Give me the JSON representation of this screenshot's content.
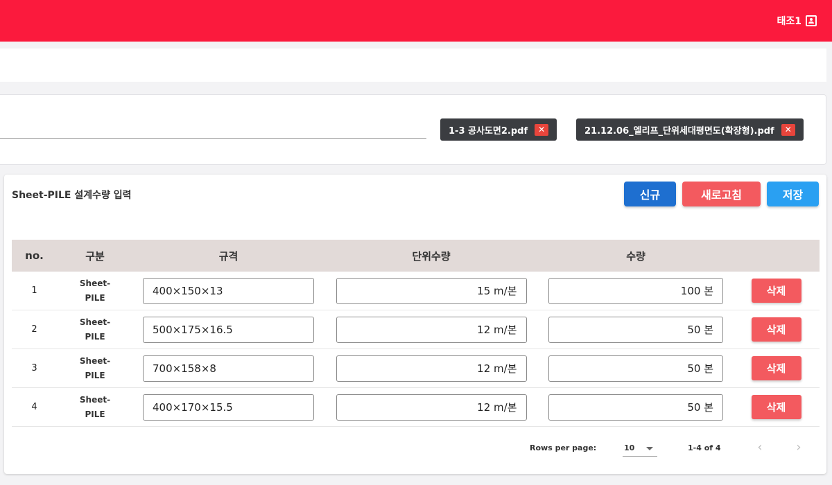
{
  "header": {
    "user_name": "태조1",
    "user_icon": "account-box-icon"
  },
  "attachments": [
    {
      "name": "1-3 공사도면2.pdf",
      "remove_icon": "close-icon"
    },
    {
      "name": "21.12.06_엘리프_단위세대평면도(확장형).pdf",
      "remove_icon": "close-icon"
    }
  ],
  "card": {
    "title": "Sheet-PILE 설계수량 입력",
    "buttons": {
      "new": "신규",
      "refresh": "새로고침",
      "save": "저장"
    },
    "button_colors": {
      "new": "#1e6fd0",
      "refresh": "#f35a5f",
      "save": "#2aa0f2"
    }
  },
  "table": {
    "headers": [
      "no.",
      "구분",
      "규격",
      "단위수량",
      "수량",
      ""
    ],
    "rows": [
      {
        "no": "1",
        "kind_line1": "Sheet-",
        "kind_line2": "PILE",
        "spec": "400×150×13",
        "unit": "15 m/본",
        "qty": "100 본",
        "delete": "삭제"
      },
      {
        "no": "2",
        "kind_line1": "Sheet-",
        "kind_line2": "PILE",
        "spec": "500×175×16.5",
        "unit": "12 m/본",
        "qty": "50 본",
        "delete": "삭제"
      },
      {
        "no": "3",
        "kind_line1": "Sheet-",
        "kind_line2": "PILE",
        "spec": "700×158×8",
        "unit": "12 m/본",
        "qty": "50 본",
        "delete": "삭제"
      },
      {
        "no": "4",
        "kind_line1": "Sheet-",
        "kind_line2": "PILE",
        "spec": "400×170×15.5",
        "unit": "12 m/본",
        "qty": "50 본",
        "delete": "삭제"
      }
    ]
  },
  "pagination": {
    "rows_per_page_label": "Rows per page:",
    "rows_per_page": "10",
    "range": "1-4 of 4",
    "prev": "‹",
    "next": "›"
  },
  "colors": {
    "topbar": "#fb1a3d",
    "header_row": "#e2dad8",
    "delete": "#f35a5f"
  }
}
